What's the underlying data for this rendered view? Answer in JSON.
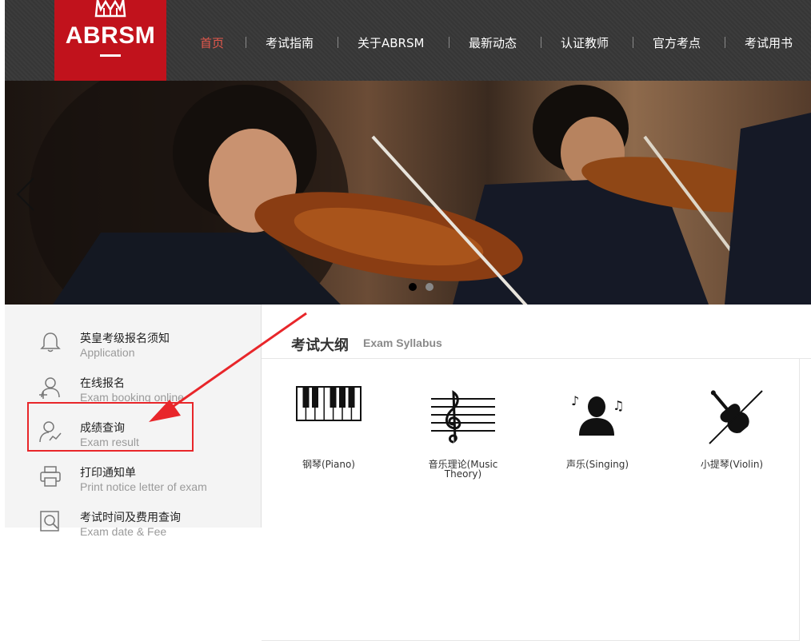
{
  "brand": {
    "name": "ABRSM",
    "color": "#c1121c"
  },
  "nav": {
    "items": [
      {
        "label": "首页",
        "active": true
      },
      {
        "label": "考试指南",
        "active": false
      },
      {
        "label": "关于ABRSM",
        "active": false
      },
      {
        "label": "最新动态",
        "active": false
      },
      {
        "label": "认证教师",
        "active": false
      },
      {
        "label": "官方考点",
        "active": false
      },
      {
        "label": "考试用书",
        "active": false
      }
    ]
  },
  "banner": {
    "slides": 2,
    "active_slide": 1
  },
  "sidebar": {
    "items": [
      {
        "zh": "英皇考级报名须知",
        "en": "Application",
        "icon": "bell-icon"
      },
      {
        "zh": "在线报名",
        "en": "Exam booking online",
        "icon": "user-add-icon"
      },
      {
        "zh": "成绩查询",
        "en": "Exam result",
        "icon": "user-chart-icon"
      },
      {
        "zh": "打印通知单",
        "en": "Print notice letter of exam",
        "icon": "printer-icon"
      },
      {
        "zh": "考试时间及费用查询",
        "en": "Exam date & Fee",
        "icon": "search-doc-icon"
      }
    ]
  },
  "syllabus": {
    "title": "考试大纲",
    "subtitle": "Exam Syllabus",
    "items": [
      {
        "label": "钢琴(Piano)",
        "icon": "piano-icon"
      },
      {
        "label": "音乐理论(Music Theory)",
        "icon": "treble-clef-icon"
      },
      {
        "label": "声乐(Singing)",
        "icon": "singer-icon"
      },
      {
        "label": "小提琴(Violin)",
        "icon": "violin-icon"
      }
    ]
  },
  "annotation": {
    "color": "#e8262a"
  }
}
